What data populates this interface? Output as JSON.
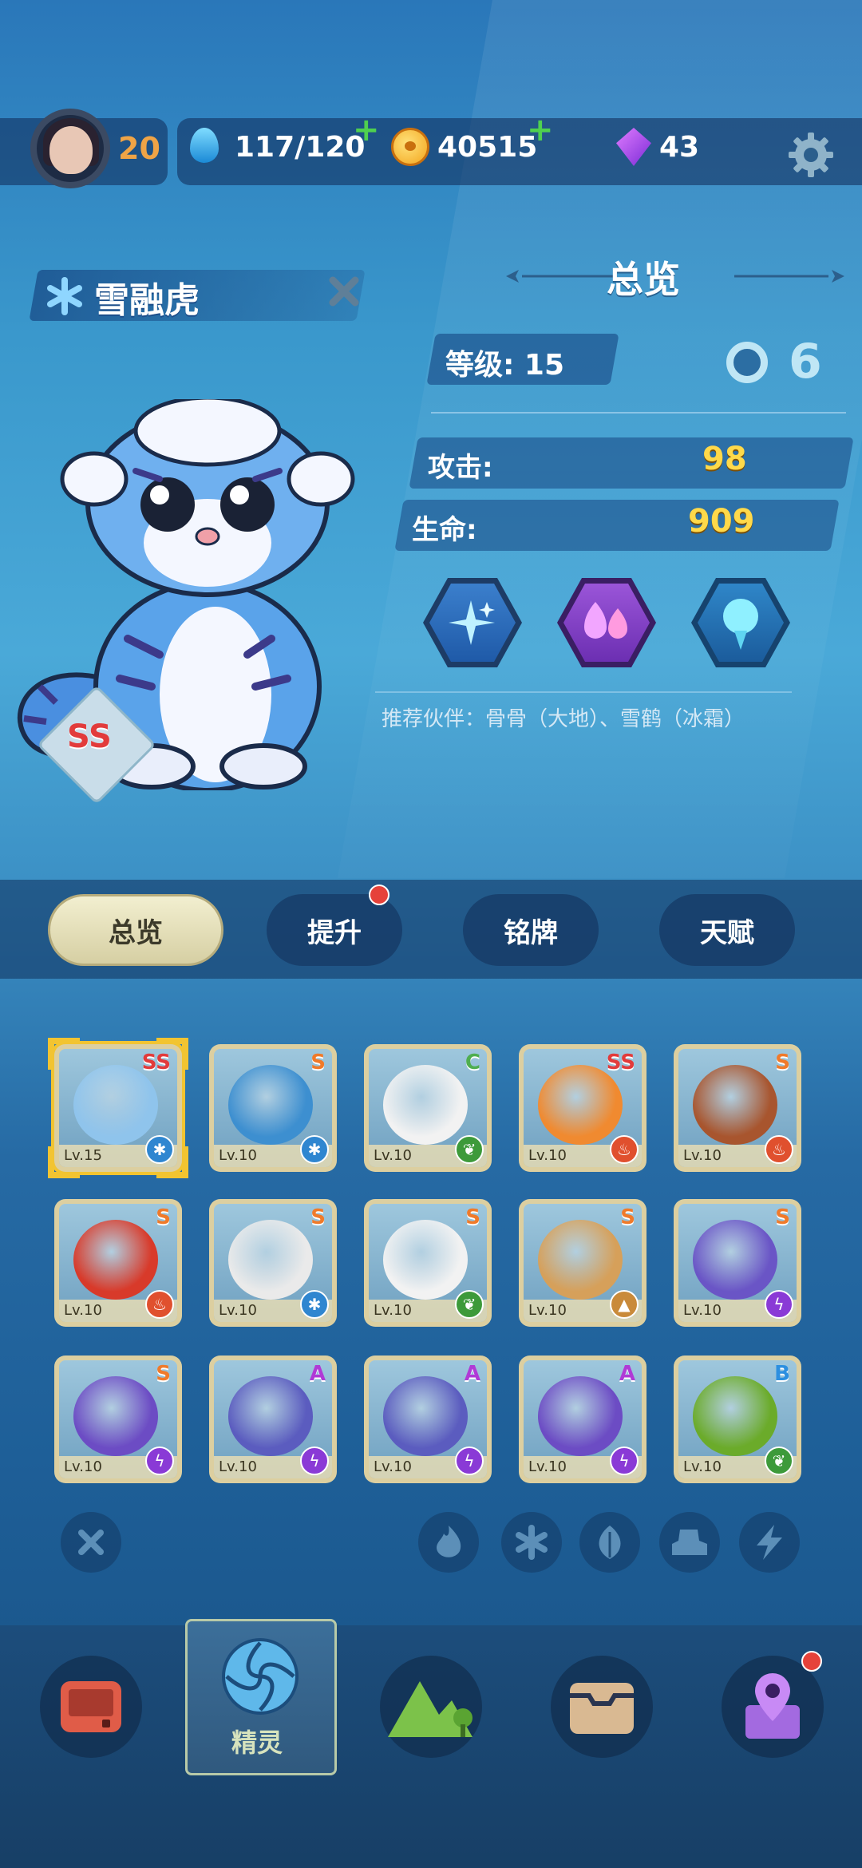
{
  "topbar": {
    "player_level": "20",
    "stamina": "117/120",
    "gold": "40515",
    "gems": "43",
    "plus": "+"
  },
  "pet": {
    "name": "雪融虎",
    "rank": "SS",
    "overview_title": "总览",
    "level_label": "等级: 15",
    "attack_label": "攻击:",
    "attack_value": "98",
    "hp_label": "生命:",
    "hp_value": "909",
    "recommend": "推荐伙伴：骨骨（大地）、雪鹤（冰霜）",
    "stars": "6"
  },
  "tabs": [
    "总览",
    "提升",
    "铭牌",
    "天赋"
  ],
  "cards": [
    {
      "lv": "Lv.15",
      "rank": "SS",
      "rank_color": "#e23b3b",
      "elem": "ice",
      "body": "#8fc4ec"
    },
    {
      "lv": "Lv.10",
      "rank": "S",
      "rank_color": "#f07a2a",
      "elem": "ice",
      "body": "#3d8fd0"
    },
    {
      "lv": "Lv.10",
      "rank": "C",
      "rank_color": "#4fae4f",
      "elem": "leaf",
      "body": "#f2f2f2"
    },
    {
      "lv": "Lv.10",
      "rank": "SS",
      "rank_color": "#e23b3b",
      "elem": "fire",
      "body": "#f08a30"
    },
    {
      "lv": "Lv.10",
      "rank": "S",
      "rank_color": "#f07a2a",
      "elem": "fire",
      "body": "#a8552e"
    },
    {
      "lv": "Lv.10",
      "rank": "S",
      "rank_color": "#f07a2a",
      "elem": "fire",
      "body": "#d83a2a"
    },
    {
      "lv": "Lv.10",
      "rank": "S",
      "rank_color": "#f07a2a",
      "elem": "ice",
      "body": "#eaeaea"
    },
    {
      "lv": "Lv.10",
      "rank": "S",
      "rank_color": "#f07a2a",
      "elem": "leaf",
      "body": "#f2f2f2"
    },
    {
      "lv": "Lv.10",
      "rank": "S",
      "rank_color": "#f07a2a",
      "elem": "earth",
      "body": "#d6a05a"
    },
    {
      "lv": "Lv.10",
      "rank": "S",
      "rank_color": "#f07a2a",
      "elem": "bolt",
      "body": "#6a55c6"
    },
    {
      "lv": "Lv.10",
      "rank": "S",
      "rank_color": "#f07a2a",
      "elem": "bolt",
      "body": "#6c4cc4"
    },
    {
      "lv": "Lv.10",
      "rank": "A",
      "rank_color": "#b03ad6",
      "elem": "bolt",
      "body": "#5b5cbf"
    },
    {
      "lv": "Lv.10",
      "rank": "A",
      "rank_color": "#b03ad6",
      "elem": "bolt",
      "body": "#5b5cbf"
    },
    {
      "lv": "Lv.10",
      "rank": "A",
      "rank_color": "#b03ad6",
      "elem": "bolt",
      "body": "#6c4cc4"
    },
    {
      "lv": "Lv.10",
      "rank": "B",
      "rank_color": "#2c8fe0",
      "elem": "leaf",
      "body": "#6bab2a"
    }
  ],
  "nav": {
    "active_label": "精灵"
  },
  "colors": {
    "gold_value": "#ffd94a",
    "level_orange": "#f0a446",
    "tab_active": "#f2efd0",
    "badge_red": "#e6423a"
  },
  "icons": [
    "water-drop-icon",
    "coin-icon",
    "gem-icon",
    "gear-icon",
    "snowflake-icon",
    "close-icon",
    "sparkle-skill-icon",
    "purple-drops-skill-icon",
    "blue-drop-skill-icon",
    "fire-icon",
    "leaf-icon",
    "earth-icon",
    "bolt-icon",
    "battle-icon",
    "spirit-icon",
    "mountain-icon",
    "chest-icon",
    "map-pin-icon"
  ]
}
